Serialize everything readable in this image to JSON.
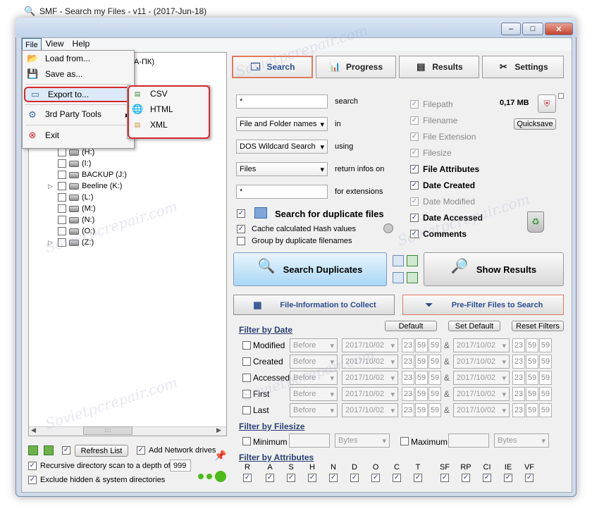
{
  "window": {
    "title": "SMF - Search my Files - v11 - (2017-Jun-18)",
    "controls": {
      "minimize": "–",
      "maximize": "□",
      "close": "✕"
    }
  },
  "menu": {
    "file": "File",
    "view": "View",
    "help": "Help"
  },
  "file_menu": {
    "load": "Load from...",
    "save": "Save as...",
    "export": "Export to...",
    "third_party": "3rd Party Tools",
    "exit": "Exit"
  },
  "export_submenu": {
    "csv": "CSV",
    "html": "HTML",
    "xml": "XML"
  },
  "tree": {
    "partial_label": "A-ПК)",
    "drives": [
      {
        "label": "(H:)",
        "expand": ""
      },
      {
        "label": "(I:)",
        "expand": ""
      },
      {
        "label": "BACKUP (J:)",
        "expand": ""
      },
      {
        "label": "Beeline (K:)",
        "expand": "▷"
      },
      {
        "label": "(L:)",
        "expand": ""
      },
      {
        "label": "(M:)",
        "expand": ""
      },
      {
        "label": "(N:)",
        "expand": ""
      },
      {
        "label": "(O:)",
        "expand": ""
      },
      {
        "label": "(Z:)",
        "expand": "▷"
      }
    ],
    "scroll_dots": "::::"
  },
  "bottom_left": {
    "refresh": "Refresh List",
    "add_network": "Add Network drives",
    "recursive": "Recursive directory scan to a depth of",
    "depth": "999",
    "exclude": "Exclude hidden & system directories"
  },
  "tabs": {
    "search": "Search",
    "progress": "Progress",
    "results": "Results",
    "settings": "Settings"
  },
  "search_form": {
    "search_value": "*",
    "search_label": "search",
    "in_value": "File and Folder names",
    "in_label": "in",
    "using_value": "DOS Wildcard Search",
    "using_label": "using",
    "return_value": "Files",
    "return_label": "return infos on",
    "ext_value": "*",
    "ext_label": "for extensions",
    "dup_label": "Search for duplicate files",
    "cache_label": "Cache calculated Hash values",
    "group_label": "Group by duplicate filenames"
  },
  "columns": {
    "filepath": "Filepath",
    "filename": "Filename",
    "file_extension": "File Extension",
    "filesize": "Filesize",
    "file_attributes": "File Attributes",
    "date_created": "Date Created",
    "date_modified": "Date Modified",
    "date_accessed": "Date Accessed",
    "comments": "Comments"
  },
  "size_label": "0,17 MB",
  "quicksave": "Quicksave",
  "buttons": {
    "search_duplicates": "Search Duplicates",
    "show_results": "Show Results",
    "file_info": "File-Information to Collect",
    "prefilter": "Pre-Filter Files to Search",
    "default": "Default",
    "set_default": "Set Default",
    "reset_filters": "Reset Filters"
  },
  "filter_date": {
    "header": "Filter by Date",
    "rows": [
      {
        "label": "Modified"
      },
      {
        "label": "Created"
      },
      {
        "label": "Accessed"
      },
      {
        "label": "First"
      },
      {
        "label": "Last"
      }
    ],
    "mode": "Before",
    "date": "2017/10/02",
    "hh": "23",
    "mm": "59",
    "ss": "59",
    "amp": "&"
  },
  "filter_size": {
    "header": "Filter by Filesize",
    "min": "Minimum",
    "max": "Maximum",
    "unit": "Bytes"
  },
  "filter_attr": {
    "header": "Filter by Attributes",
    "letters": [
      "R",
      "A",
      "S",
      "H",
      "N",
      "D",
      "O",
      "C",
      "T",
      "SF",
      "RP",
      "CI",
      "IE",
      "VF"
    ]
  },
  "watermark": "Sovietpcrepair.com",
  "colors": {
    "highlight": "#d6272e",
    "accent_tab": "#e07a5f",
    "header": "#2a3f73"
  }
}
